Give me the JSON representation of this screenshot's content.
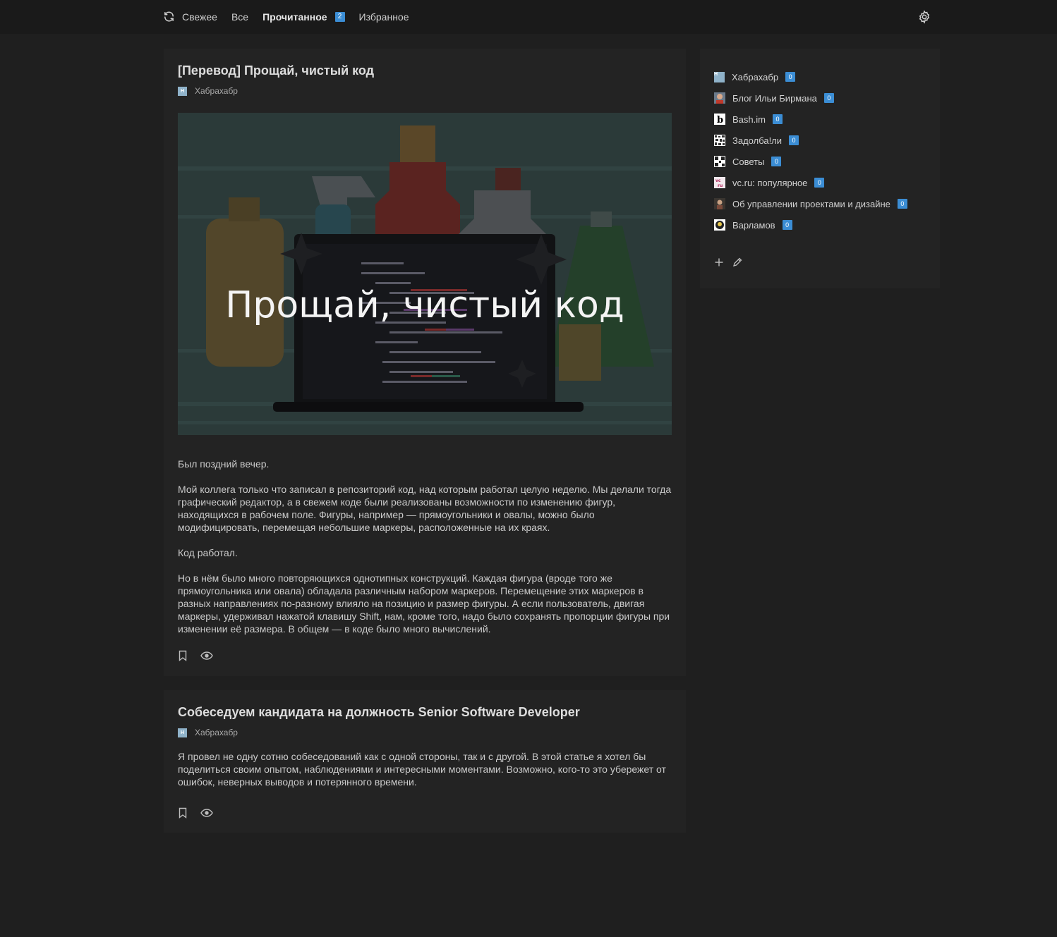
{
  "nav": {
    "items": [
      {
        "label": "Свежее",
        "icon": "refresh-icon"
      },
      {
        "label": "Все"
      },
      {
        "label": "Прочитанное",
        "badge": "2",
        "active": true
      },
      {
        "label": "Избранное"
      }
    ],
    "settings_icon": "gear-icon"
  },
  "posts": [
    {
      "title": "[Перевод] Прощай, чистый код",
      "source": "Хабрахабр",
      "source_icon_letter": "H",
      "image_caption": "Прощай, чистый код",
      "paragraphs": [
        "Был поздний вечер.",
        "Мой коллега только что записал в репозиторий код, над которым работал целую неделю. Мы делали тогда графический редактор, а в свежем коде были реализованы возможности по изменению фигур, находящихся в рабочем поле. Фигуры, например — прямоугольники и овалы, можно было модифицировать, перемещая небольшие маркеры, расположенные на их краях.",
        "Код работал.",
        "Но в нём было много повторяющихся однотипных конструкций. Каждая фигура (вроде того же прямоугольника или овала) обладала различным набором маркеров. Перемещение этих маркеров в разных направлениях по-разному влияло на позицию и размер фигуры. А если пользователь, двигая маркеры, удерживал нажатой клавишу Shift, нам, кроме того, надо было сохранять пропорции фигуры при изменении её размера. В общем — в коде было много вычислений."
      ]
    },
    {
      "title": "Собеседуем кандидата на должность Senior Software Developer",
      "source": "Хабрахабр",
      "source_icon_letter": "H",
      "paragraphs": [
        "Я провел не одну сотню собеседований как с одной стороны, так и с другой. В этой статье я хотел бы поделиться своим опытом, наблюдениями и интересными моментами. Возможно, кого-то это убережет от ошибок, неверных выводов и потерянного времени."
      ]
    }
  ],
  "sidebar": {
    "feeds": [
      {
        "label": "Хабрахабр",
        "count": "0",
        "icon": "habr-icon"
      },
      {
        "label": "Блог Ильи Бирмана",
        "count": "0",
        "icon": "birman-avatar-icon"
      },
      {
        "label": "Bash.im",
        "count": "0",
        "icon": "bash-icon"
      },
      {
        "label": "Задолба!ли",
        "count": "0",
        "icon": "zadolbali-icon"
      },
      {
        "label": "Советы",
        "count": "0",
        "icon": "sovety-icon"
      },
      {
        "label": "vc.ru: популярное",
        "count": "0",
        "icon": "vc-icon"
      },
      {
        "label": "Об управлении проектами и дизайне",
        "count": "0",
        "icon": "pm-avatar-icon"
      },
      {
        "label": "Варламов",
        "count": "0",
        "icon": "varlamov-icon"
      }
    ]
  },
  "colors": {
    "background": "#1f1f1f",
    "card": "#232323",
    "badge": "#3b8dd4"
  }
}
